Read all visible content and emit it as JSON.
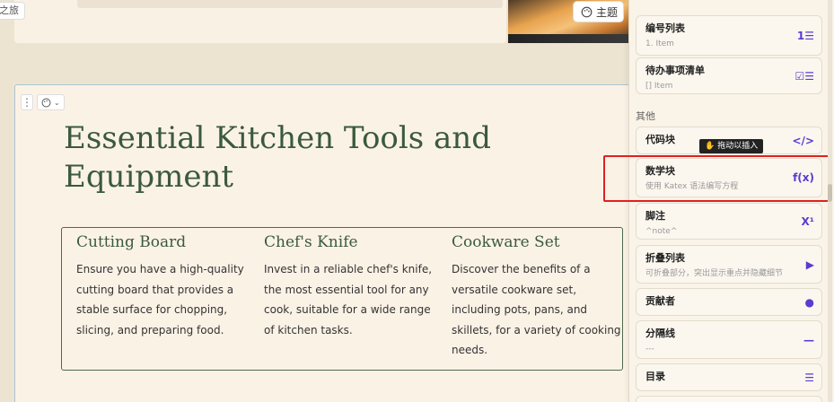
{
  "top_bar": {
    "left_chip": "之旅",
    "theme_label": "主题"
  },
  "section": {
    "title": "Essential Kitchen Tools and Equipment",
    "cards": [
      {
        "title": "Cutting Board",
        "text": "Ensure you have a high-quality cutting board that provides a stable surface for chopping, slicing, and preparing food."
      },
      {
        "title": "Chef's Knife",
        "text": "Invest in a reliable chef's knife, the most essential tool for any cook, suitable for a wide range of kitchen tasks."
      },
      {
        "title": "Cookware Set",
        "text": "Discover the benefits of a versatile cookware set, including pots, pans, and skillets, for a variety of cooking needs."
      }
    ]
  },
  "panel": {
    "items": [
      {
        "label": "编号列表",
        "sub": "1. Item",
        "icon": "numbered-list-icon",
        "glyph": "1☰"
      },
      {
        "label": "待办事项清单",
        "sub": "[] Item",
        "icon": "checklist-icon",
        "glyph": "☑☰"
      },
      {
        "label": "代码块",
        "sub": "",
        "icon": "code-icon",
        "glyph": "</>"
      },
      {
        "label": "数学块",
        "sub": "使用 Katex 语法编写方程",
        "icon": "function-icon",
        "glyph": "f(x)"
      },
      {
        "label": "脚注",
        "sub": "^note^",
        "icon": "superscript-icon",
        "glyph": "X¹"
      },
      {
        "label": "折叠列表",
        "sub": "可折叠部分，突出显示重点并隐藏细节",
        "icon": "play-icon",
        "glyph": "▶"
      },
      {
        "label": "贡献者",
        "sub": "",
        "icon": "user-icon",
        "glyph": "●"
      },
      {
        "label": "分隔线",
        "sub": "---",
        "icon": "divider-icon",
        "glyph": "—"
      },
      {
        "label": "目录",
        "sub": "",
        "icon": "toc-icon",
        "glyph": "☰"
      }
    ],
    "group_label": "其他",
    "tooltip": "拖动以插入"
  },
  "colors": {
    "accent": "#5b2bd8",
    "title_green": "#3a5a3c",
    "highlight_red": "#e02020"
  }
}
